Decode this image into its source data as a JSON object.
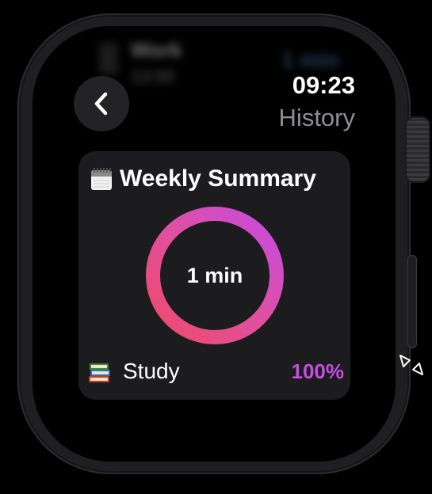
{
  "background_row": {
    "title": "Work",
    "subtitle": "13:50",
    "value": "1 min"
  },
  "status": {
    "time": "09:23",
    "title": "History"
  },
  "summary": {
    "title": "Weekly Summary",
    "title_icon": "calendar-icon",
    "total_label": "1 min",
    "ring_gradient": [
      "#ef4a6a",
      "#e0509e",
      "#c64be3"
    ],
    "items": [
      {
        "icon": "books-icon",
        "label": "Study",
        "percent": "100%",
        "share": 1.0,
        "color": "#c54de0"
      }
    ]
  },
  "colors": {
    "accent_purple": "#c54de0",
    "accent_pink": "#ef4a6a",
    "card_bg": "#1c1c1e",
    "secondary_text": "#8e8e93"
  }
}
